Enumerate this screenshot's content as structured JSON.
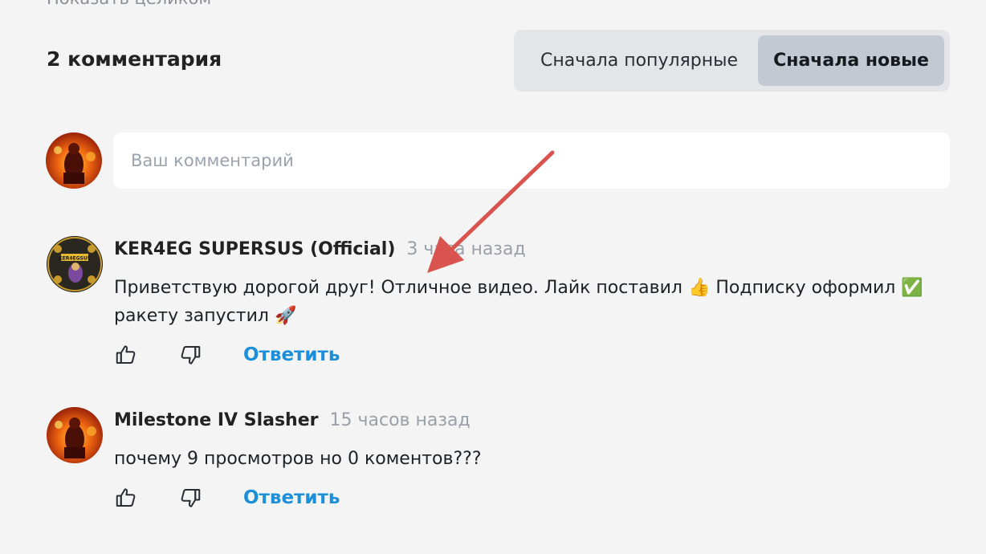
{
  "top": {
    "show_all_label": "Показать целиком"
  },
  "header": {
    "comment_count": "2 комментария",
    "sort": {
      "popular_label": "Сначала популярные",
      "new_label": "Сначала новые",
      "selected": "new"
    }
  },
  "compose": {
    "placeholder": "Ваш комментарий",
    "value": ""
  },
  "comments": [
    {
      "author": "KER4EG SUPERSUS (Official)",
      "time": "3 часа назад",
      "text_line1": "Приветствую дорогой друг! Отличное видео. Лайк поставил 👍 Подписку оформил ✅",
      "text_line2": "ракету запустил 🚀",
      "avatar_text": "KER4EGSUS",
      "reply_label": "Ответить",
      "like_icon": "thumbs-up-icon",
      "dislike_icon": "thumbs-down-icon"
    },
    {
      "author": "Milestone IV Slasher",
      "time": "15 часов назад",
      "text_line1": "почему 9 просмотров но 0 коментов???",
      "reply_label": "Ответить",
      "like_icon": "thumbs-up-icon",
      "dislike_icon": "thumbs-down-icon"
    }
  ],
  "colors": {
    "background": "#f4f4f4",
    "accent_link": "#1b8fd9",
    "arrow_annotation": "#d9534f",
    "sort_selected_bg": "#c2c9d2"
  }
}
